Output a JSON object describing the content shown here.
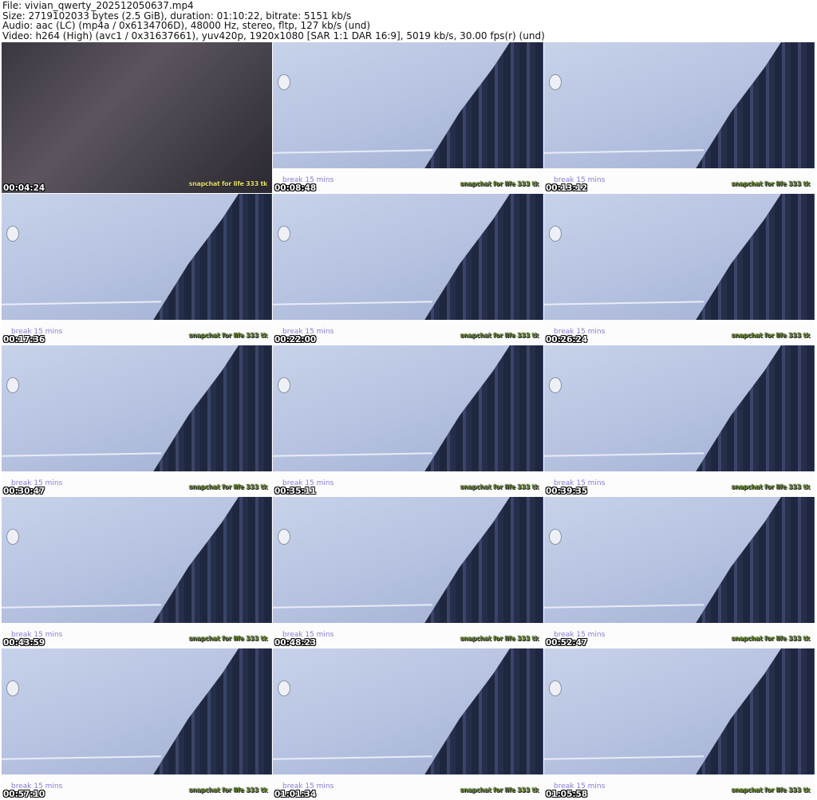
{
  "header": {
    "file": "File: vivian_qwerty_202512050637.mp4",
    "size": "Size: 2719102033 bytes (2.5 GiB), duration: 01:10:22, bitrate: 5151 kb/s",
    "audio": "Audio: aac (LC) (mp4a / 0x6134706D), 48000 Hz, stereo, fltp, 127 kb/s (und)",
    "video": "Video: h264 (High) (avc1 / 0x31637661), yuv420p, 1920x1080 [SAR 1:1 DAR 16:9], 5019 kb/s, 30.00 fps(r) (und)"
  },
  "overlay": {
    "break_text": "break  15 mins",
    "snap_text": "snapchat for life 333 tk"
  },
  "thumbnails": [
    {
      "timestamp": "00:04:24",
      "kind": "live"
    },
    {
      "timestamp": "00:08:48",
      "kind": "break"
    },
    {
      "timestamp": "00:13:12",
      "kind": "break"
    },
    {
      "timestamp": "00:17:36",
      "kind": "break"
    },
    {
      "timestamp": "00:22:00",
      "kind": "break"
    },
    {
      "timestamp": "00:26:24",
      "kind": "break"
    },
    {
      "timestamp": "00:30:47",
      "kind": "break"
    },
    {
      "timestamp": "00:35:11",
      "kind": "break"
    },
    {
      "timestamp": "00:39:35",
      "kind": "break"
    },
    {
      "timestamp": "00:43:59",
      "kind": "break"
    },
    {
      "timestamp": "00:48:23",
      "kind": "break"
    },
    {
      "timestamp": "00:52:47",
      "kind": "break"
    },
    {
      "timestamp": "00:57:10",
      "kind": "break"
    },
    {
      "timestamp": "01:01:34",
      "kind": "break"
    },
    {
      "timestamp": "01:05:58",
      "kind": "break"
    }
  ]
}
